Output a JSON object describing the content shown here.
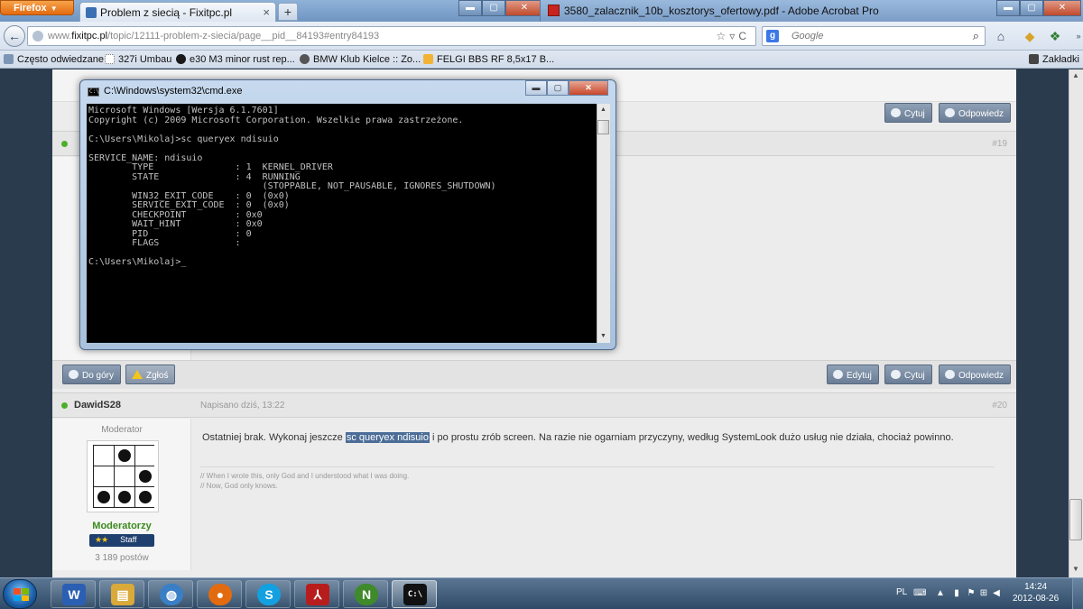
{
  "browser": {
    "menu_button": "Firefox",
    "active_tab": "Problem z siecią - Fixitpc.pl",
    "new_tab": "+",
    "url_domain": "fixitpc.pl",
    "url_prefix": "www.",
    "url_path": "/topic/12111-problem-z-siecia/page__pid__84193#entry84193",
    "search_engine": "Google",
    "search_placeholder": "Google",
    "bookmarks": [
      {
        "label": "Często odwiedzane"
      },
      {
        "label": "327i Umbau"
      },
      {
        "label": "e30 M3 minor rust rep..."
      },
      {
        "label": "BMW Klub Kielce :: Zo..."
      },
      {
        "label": "FELGI BBS RF 8,5x17 B..."
      }
    ],
    "bookmarks_menu": "Zakładki"
  },
  "background_window": {
    "title": "3580_zalacznik_10b_kosztorys_ofertowy.pdf - Adobe Acrobat Pro"
  },
  "cmd": {
    "title": "C:\\Windows\\system32\\cmd.exe",
    "output": "Microsoft Windows [Wersja 6.1.7601]\nCopyright (c) 2009 Microsoft Corporation. Wszelkie prawa zastrzeżone.\n\nC:\\Users\\Mikolaj>sc queryex ndisuio\n\nSERVICE_NAME: ndisuio\n        TYPE               : 1  KERNEL_DRIVER\n        STATE              : 4  RUNNING\n                                (STOPPABLE, NOT_PAUSABLE, IGNORES_SHUTDOWN)\n        WIN32_EXIT_CODE    : 0  (0x0)\n        SERVICE_EXIT_CODE  : 0  (0x0)\n        CHECKPOINT         : 0x0\n        WAIT_HINT          : 0x0\n        PID                : 0\n        FLAGS              :\n\nC:\\Users\\Mikolaj>_"
  },
  "forum": {
    "prev_post": {
      "number": "#19",
      "buttons": {
        "quote": "Cytuj",
        "reply": "Odpowiedz"
      }
    },
    "action_bar": {
      "top": "Do góry",
      "report": "Zgłoś",
      "edit": "Edytuj",
      "quote": "Cytuj",
      "reply": "Odpowiedz"
    },
    "post": {
      "author": "DawidS28",
      "posted": "Napisano dziś, 13:22",
      "number": "#20",
      "role": "Moderator",
      "group": "Moderatorzy",
      "rank_stars": "★★",
      "rank": "Staff",
      "post_count": "3 189 postów",
      "text_before": "Ostatniej brak. Wykonaj jeszcze ",
      "highlight": "sc queryex ndisuio",
      "text_after": " i po prostu zrób screen. Na razie nie ogarniam przyczyny, według SystemLook dużo usług nie działa, chociaż powinno.",
      "signature_line1": "// When I wrote this, only God and I understood what I was doing.",
      "signature_line2": "// Now, God only knows."
    }
  },
  "taskbar": {
    "language": "PL",
    "time": "14:24",
    "date": "2012-08-26",
    "apps": [
      {
        "name": "Word",
        "glyph": "W",
        "color": "#2b5fb3"
      },
      {
        "name": "Explorer",
        "glyph": "▤",
        "color": "#d9a93a"
      },
      {
        "name": "Skype-like",
        "glyph": "◍",
        "color": "#3a7fc5"
      },
      {
        "name": "Firefox",
        "glyph": "●",
        "color": "#e36b0f"
      },
      {
        "name": "Skype",
        "glyph": "S",
        "color": "#13a0e0"
      },
      {
        "name": "Acrobat",
        "glyph": "⅄",
        "color": "#b81d1d"
      },
      {
        "name": "Norton",
        "glyph": "N",
        "color": "#3f8a2a"
      },
      {
        "name": "Command Prompt",
        "glyph": "C:\\",
        "color": "#111111"
      }
    ]
  }
}
